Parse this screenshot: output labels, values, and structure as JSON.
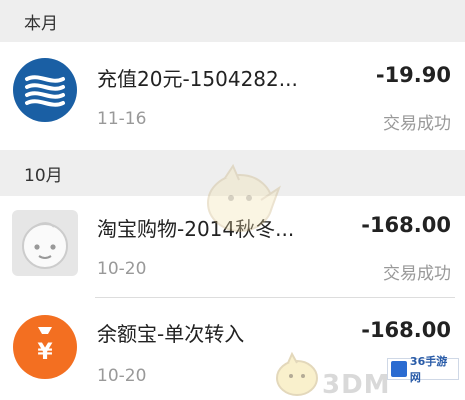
{
  "sections": [
    {
      "header": "本月",
      "items": [
        {
          "icon": "china-mobile-logo-icon",
          "title": "充值20元-1504282...",
          "amount": "-19.90",
          "date": "11-16",
          "status": "交易成功"
        }
      ]
    },
    {
      "header": "10月",
      "items": [
        {
          "icon": "taobao-face-icon",
          "title": "淘宝购物-2014秋冬...",
          "amount": "-168.00",
          "date": "10-20",
          "status": "交易成功"
        },
        {
          "icon": "yuebao-money-bag-icon",
          "title": "余额宝-单次转入",
          "amount": "-168.00",
          "date": "10-20",
          "status": ""
        }
      ]
    }
  ],
  "yuebao_symbol": "¥",
  "watermark": {
    "text": "3DM",
    "badge": "36手游网"
  },
  "colors": {
    "china_mobile_blue": "#1a5fa4",
    "yuebao_orange": "#f36f21",
    "header_bg": "#eeeeee"
  }
}
